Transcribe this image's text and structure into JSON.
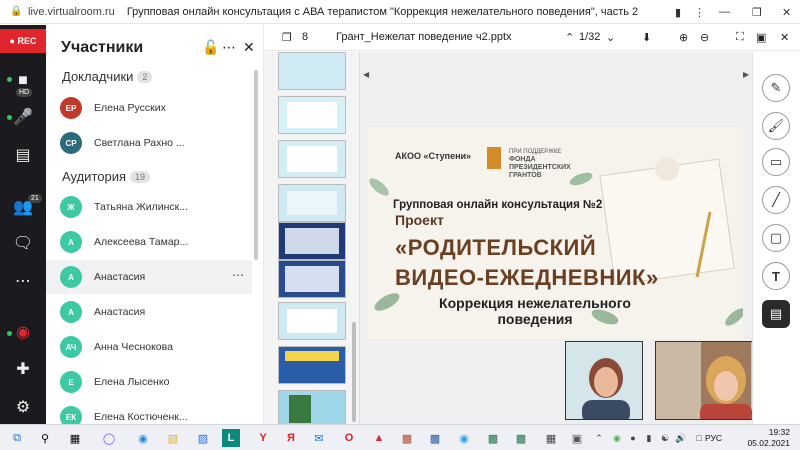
{
  "browser": {
    "url": "live.virtualroom.ru",
    "page_title": "Групповая онлайн консультация с АВА терапистом \"Коррекция нежелательного поведения\", часть 2"
  },
  "rail": {
    "rec_label": "REC",
    "camera_badge": "HD",
    "participants_badge": "21"
  },
  "participants": {
    "title": "Участники",
    "speakers": {
      "label": "Докладчики",
      "count": "2",
      "items": [
        {
          "initials": "ЕР",
          "name": "Елена Русских",
          "color": "#c0392b"
        },
        {
          "initials": "СР",
          "name": "Светлана Рахно ...",
          "color": "#2c6a7e"
        }
      ]
    },
    "audience": {
      "label": "Аудитория",
      "count": "19",
      "items": [
        {
          "initials": "Ж",
          "name": "Татьяна Жилинск...",
          "color": "#3cc9a3"
        },
        {
          "initials": "А",
          "name": "Алексеева Тамар...",
          "color": "#3cc9a3"
        },
        {
          "initials": "А",
          "name": "Анастасия",
          "color": "#3cc9a3"
        },
        {
          "initials": "А",
          "name": "Анастасия",
          "color": "#3cc9a3"
        },
        {
          "initials": "АЧ",
          "name": "Анна Чеснокова",
          "color": "#3cc9a3"
        },
        {
          "initials": "Е",
          "name": "Елена Лысенко",
          "color": "#3cc9a3"
        },
        {
          "initials": "ЕК",
          "name": "Елена Костюченк...",
          "color": "#3cc9a3"
        }
      ]
    }
  },
  "presentation": {
    "slide_count": "8",
    "file_name": "Грант_Нежелат поведение ч2.pptx",
    "page_indicator": "1/32"
  },
  "slide": {
    "org": "АКОО «Ступени»",
    "fund": "ПРИ ПОДДЕРЖКЕ\nФОНДА\nПРЕЗИДЕНТСКИХ\nГРАНТОВ",
    "line1": "Групповая онлайн консультация №2",
    "line2": "Проект",
    "line3": "«РОДИТЕЛЬСКИЙ",
    "line4": "ВИДЕО-ЕЖЕДНЕВНИК»",
    "line5": "Коррекция нежелательного поведения"
  },
  "taskbar": {
    "lang": "РУС",
    "time": "19:32",
    "date": "05.02.2021"
  }
}
